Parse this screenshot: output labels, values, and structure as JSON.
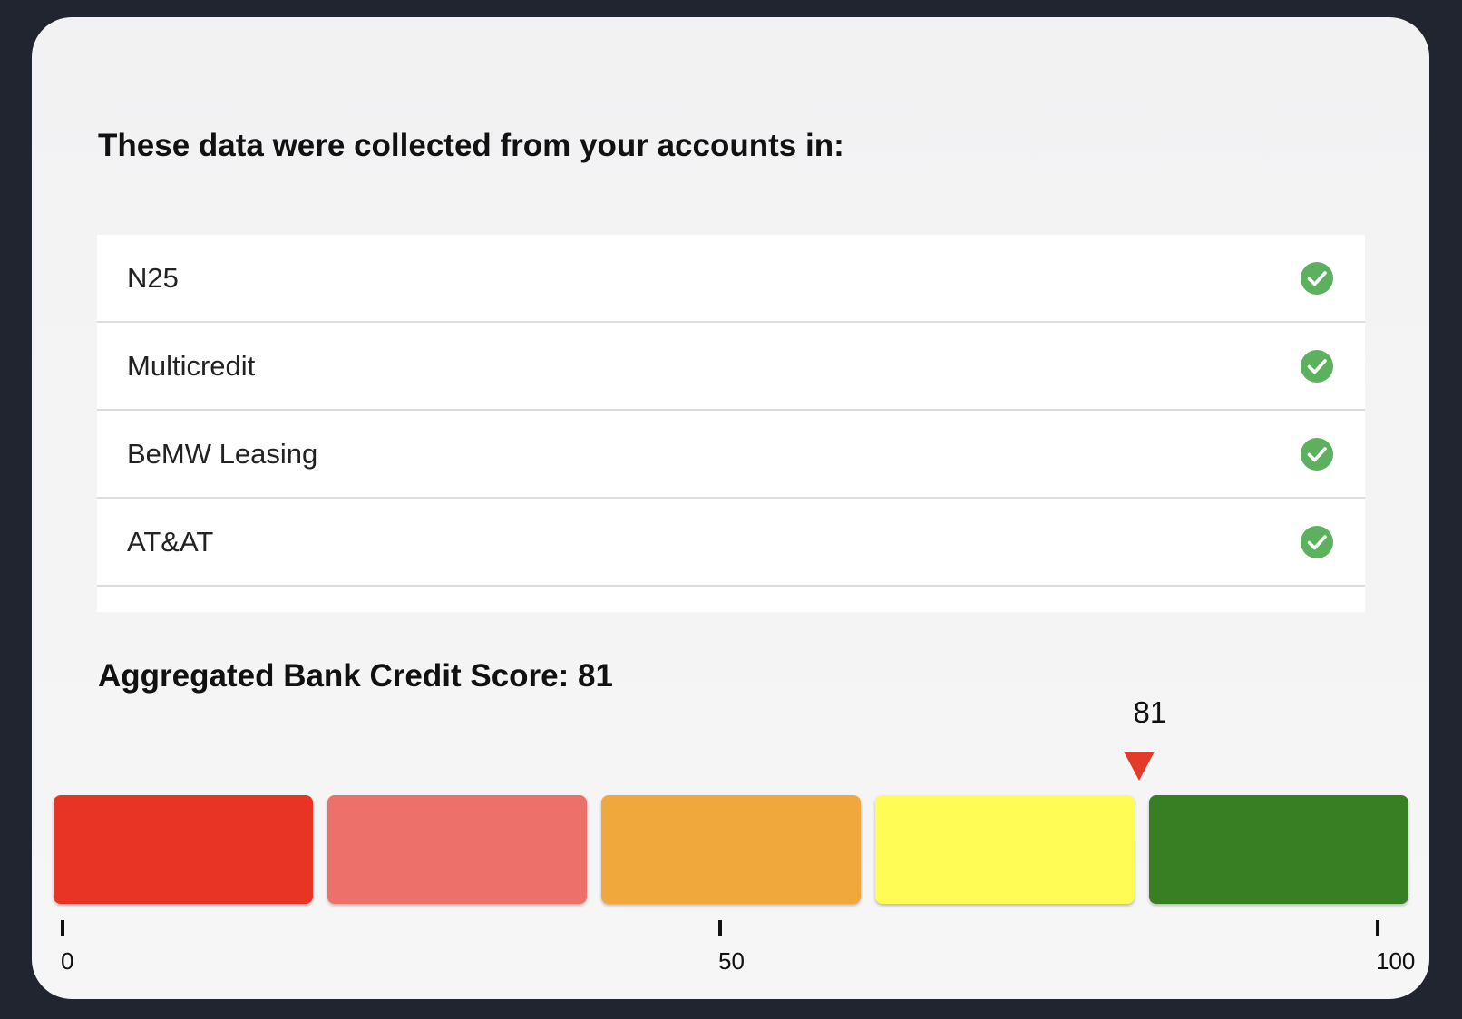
{
  "accounts_section": {
    "heading": "These data were collected from your accounts in:",
    "items": [
      {
        "name": "N25",
        "status_icon": "check-circle-icon",
        "status": "connected"
      },
      {
        "name": "Multicredit",
        "status_icon": "check-circle-icon",
        "status": "connected"
      },
      {
        "name": "BeMW Leasing",
        "status_icon": "check-circle-icon",
        "status": "connected"
      },
      {
        "name": "AT&AT",
        "status_icon": "check-circle-icon",
        "status": "connected"
      }
    ],
    "check_color": "#5cb05e"
  },
  "score_section": {
    "title": "Aggregated Bank Credit Score: 81",
    "score": 81,
    "score_label": "81",
    "min": 0,
    "max": 100,
    "ticks": [
      {
        "value": 0,
        "label": "0"
      },
      {
        "value": 50,
        "label": "50"
      },
      {
        "value": 100,
        "label": "100"
      }
    ],
    "segment_colors": [
      "#e83425",
      "#ee706b",
      "#f0a83c",
      "#fffd55",
      "#377f22"
    ],
    "marker_color": "#e43a2c"
  }
}
